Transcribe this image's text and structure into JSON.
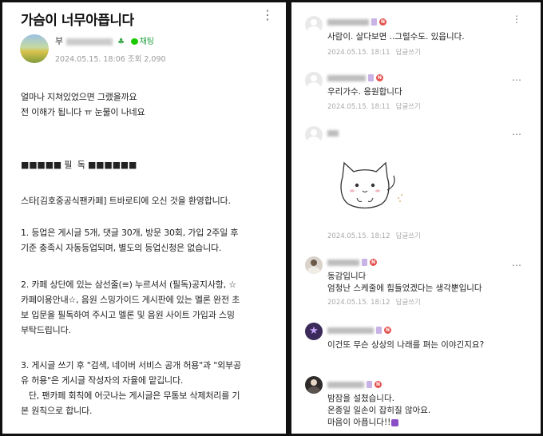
{
  "post": {
    "title": "가슴이 너무아픕니다",
    "author": "부",
    "chat_label": "채팅",
    "meta": "2024.05.15. 18:06 조회 2,090",
    "body_lines": [
      "얼마나 지쳐있었으면 그랬을까요",
      "전 이해가 됩니다 ㅠ 눈물이 나네요",
      "",
      "",
      "■■■■■ 필  독 ■■■■■■",
      "",
      "스타[김호중공식팬카페] 트바로티에 오신 것을 환영합니다.",
      "",
      "1. 등업은 게시글 5개, 댓글 30개, 방문 30회, 가입 2주일 후",
      "기준 충족시 자동등업되며, 별도의 등업신청은 없습니다.",
      "",
      "2. 카페 상단에 있는 삼선줄(≡) 누르셔서 (필독)공지사항, ☆",
      "카페이용안내☆, 음원 스밍가이드 게시판에 있는 멜론 완전 초",
      "보 입문을 필독하여 주시고 멜론 및 음원 사이트 가입과 스밍",
      "부탁드립니다.",
      "",
      "3. 게시글 쓰기 후 \"검색, 네이버 서비스 공개 허용\"과 \"외부공",
      "유 허용\"은 게시글 작성자의 자율에 맡깁니다.",
      "   단, 팬카페 회칙에 어긋나는 게시글은 무통보 삭제처리를 기",
      "본 원칙으로 합니다."
    ]
  },
  "comments": [
    {
      "text": "사람이. 살다보면 ..그럴수도. 있읍니다.",
      "date": "2024.05.15. 18:11",
      "reply": "답글쓰기"
    },
    {
      "text": "우리가수. 응원합니다",
      "date": "2024.05.15. 18:11",
      "reply": "답글쓰기"
    },
    {
      "text": "",
      "date": "2024.05.15. 18:12",
      "reply": "답글쓰기"
    },
    {
      "text": "동감입니다\n엄청난 스케줄에 힘들었겠다는 생각뿐입니다",
      "date": "2024.05.15. 18:12",
      "reply": "답글쓰기"
    },
    {
      "text": "이건또 무슨 상상의 나래를 펴는 이야긴지요?",
      "date": "",
      "reply": ""
    },
    {
      "text": "밤잠을 설쳤습니다.\n온종일 일손이 잡히질 않아요.\n마음이 아픕니다!!",
      "date": "",
      "reply": ""
    }
  ],
  "icons": {
    "more_vertical": "more-vertical-icon",
    "more_horizontal": "more-horizontal-icon",
    "sprout": "sprout-icon",
    "chat": "chat-icon",
    "new_badge": "N"
  },
  "colors": {
    "accent_green": "#1ec800",
    "new_badge": "#e2534f",
    "level_badge": "#c9b3e6",
    "heart": "#8a4fc7"
  }
}
